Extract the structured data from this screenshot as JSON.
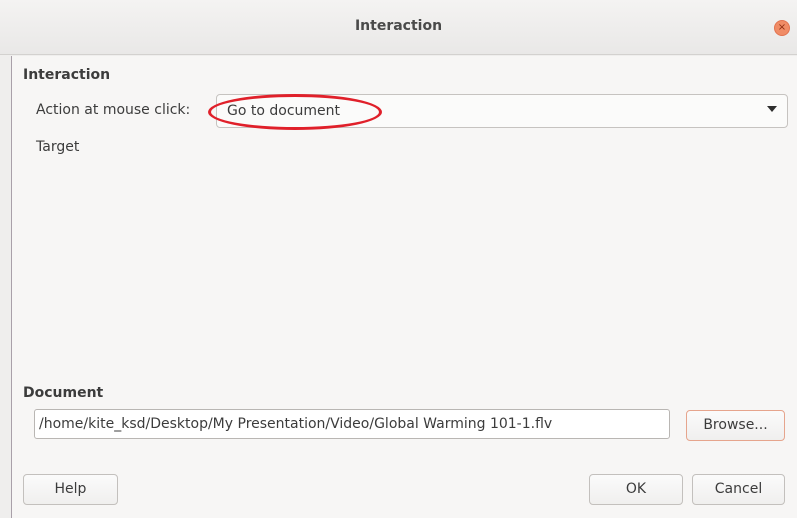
{
  "window": {
    "title": "Interaction",
    "close_glyph": "×"
  },
  "interaction": {
    "section_label": "Interaction",
    "action_label": "Action at mouse click:",
    "action_value": "Go to document",
    "target_label": "Target"
  },
  "document": {
    "section_label": "Document",
    "path_value": "/home/kite_ksd/Desktop/My Presentation/Video/Global Warming 101-1.flv",
    "browse_label": "Browse..."
  },
  "footer": {
    "help_label": "Help",
    "ok_label": "OK",
    "cancel_label": "Cancel"
  },
  "colors": {
    "highlight_ellipse": "#e0202a",
    "close_button": "#f08c66"
  }
}
